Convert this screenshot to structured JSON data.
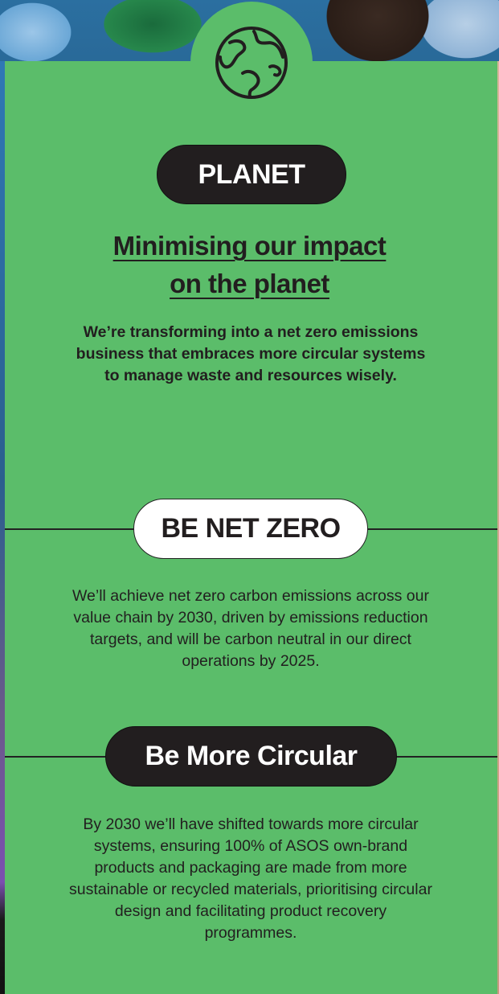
{
  "section": {
    "icon": "globe-icon",
    "badge_label": "PLANET",
    "heading_line1": "Minimising our impact",
    "heading_line2": "on the planet",
    "intro": "We’re transforming into a net zero emissions business that embraces more circular systems to manage waste and resources wisely."
  },
  "pillars": [
    {
      "label": "BE NET ZERO",
      "text": "We’ll achieve net zero carbon emissions across our value chain by 2030, driven by emissions reduction targets, and will be carbon neutral in our direct operations by 2025."
    },
    {
      "label": "Be More Circular",
      "text": "By 2030 we’ll have shifted towards more circular systems, ensuring 100% of ASOS own-brand products and packaging are made from more sustainable or recycled materials, prioritising circular design and facilitating product recovery programmes."
    }
  ],
  "colors": {
    "card_green": "#5bbd6a",
    "pill_dark": "#221e1f",
    "text": "#221e1f"
  }
}
